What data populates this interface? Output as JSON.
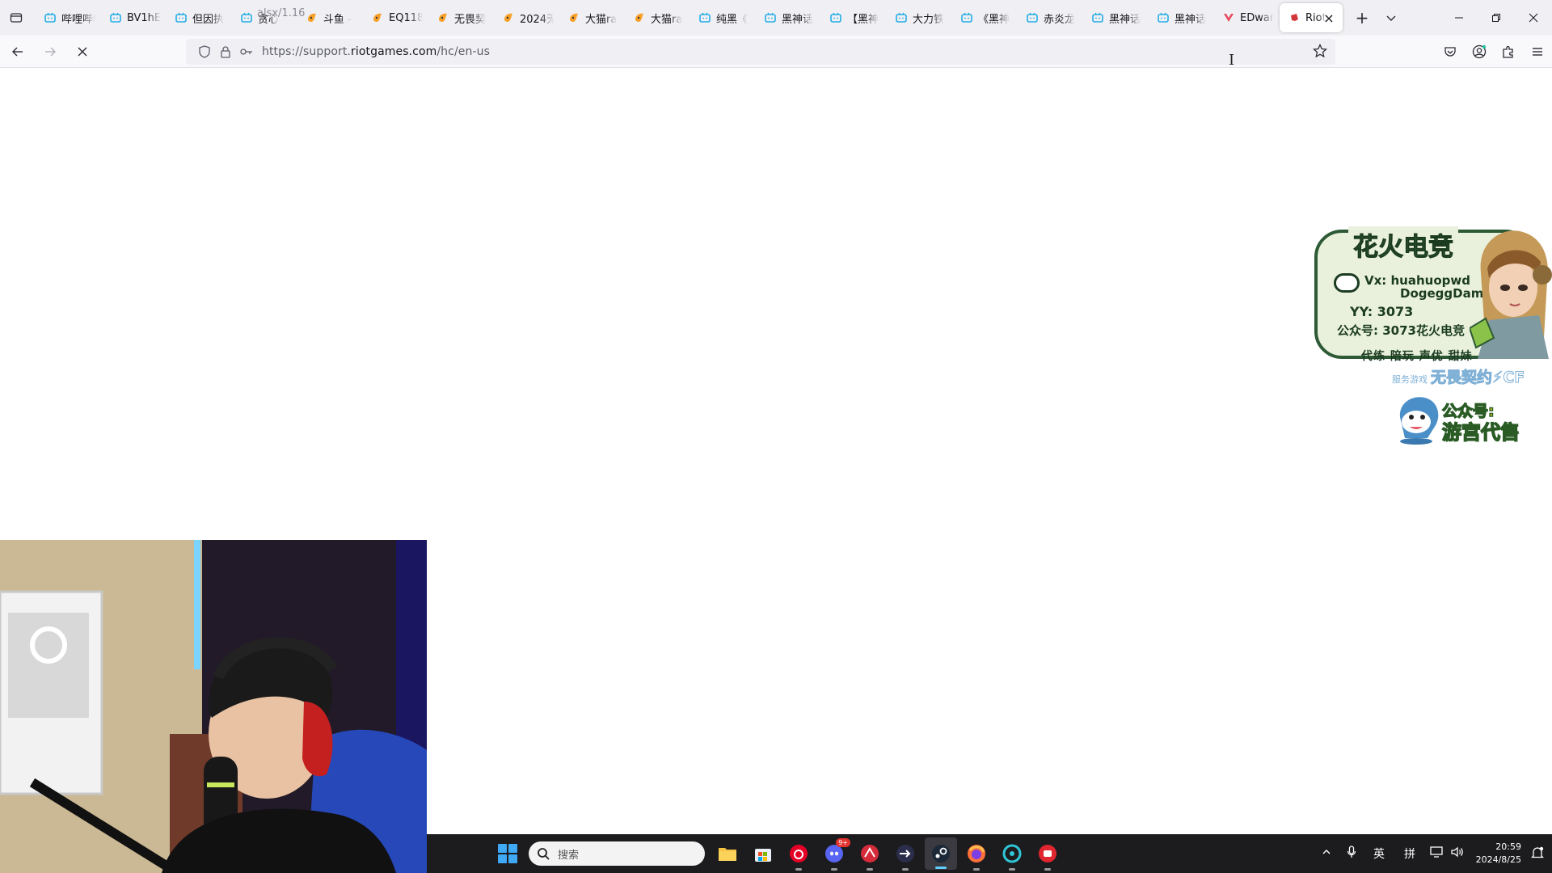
{
  "browser": {
    "tabs": [
      {
        "title": "哔哩哔哩",
        "icon": "bilibili-icon"
      },
      {
        "title": "BV1hE",
        "icon": "bilibili-icon"
      },
      {
        "title": "但因执",
        "icon": "bilibili-icon"
      },
      {
        "title": "贪心",
        "icon": "bilibili-icon"
      },
      {
        "title": "斗鱼 -",
        "icon": "douyu-icon"
      },
      {
        "title": "EQ118",
        "icon": "douyu-icon"
      },
      {
        "title": "无畏契",
        "icon": "douyu-icon"
      },
      {
        "title": "2024无",
        "icon": "douyu-icon"
      },
      {
        "title": "大猫ra",
        "icon": "douyu-icon"
      },
      {
        "title": "大猫ra",
        "icon": "douyu-icon"
      },
      {
        "title": "纯黑《",
        "icon": "bilibili-icon"
      },
      {
        "title": "黑神话",
        "icon": "bilibili-icon"
      },
      {
        "title": "【黑神",
        "icon": "bilibili-icon"
      },
      {
        "title": "大力铁",
        "icon": "bilibili-icon"
      },
      {
        "title": "《黑神",
        "icon": "bilibili-icon"
      },
      {
        "title": "赤炎龙",
        "icon": "bilibili-icon"
      },
      {
        "title": "黑神话",
        "icon": "bilibili-icon"
      },
      {
        "title": "黑神话",
        "icon": "bilibili-icon"
      },
      {
        "title": "EDwar",
        "icon": "valorant-icon"
      }
    ],
    "active_tab": {
      "title": "Riot",
      "icon": "riot-icon"
    },
    "ghost_tab_text": "alsx/1.16",
    "url_prefix": "https://support.",
    "url_domain": "riotgames.com",
    "url_suffix": "/hc/en-us"
  },
  "overlay": {
    "title": "花火电竞",
    "vx_label": "Vx: huahuopwd",
    "vx_label2": "DogeggDamn",
    "yy": "YY: 3073",
    "gzh": "公众号: 3073花火电竞",
    "footer": "代练 陪玩 声优 甜妹",
    "sub_small": "服务游戏",
    "sub_main": "无畏契约⚡CF",
    "mascot_line1": "公众号:",
    "mascot_line2": "游宫代售"
  },
  "taskbar": {
    "search_placeholder": "搜索",
    "discord_badge": "9+",
    "ime_lang": "英",
    "ime_mode": "拼",
    "time": "20:59",
    "date": "2024/8/25"
  }
}
